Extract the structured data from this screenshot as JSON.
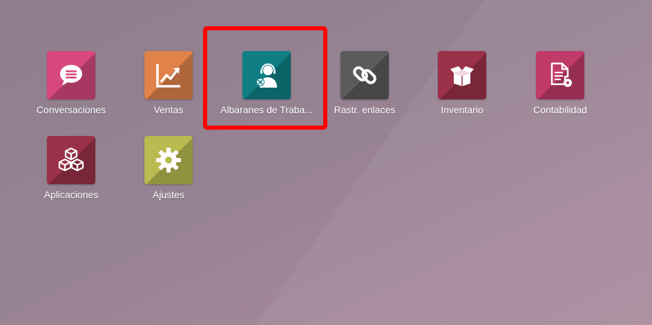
{
  "apps": [
    {
      "label": "Conversaciones",
      "icon": "chat-bubble-icon",
      "color": "#d6487e"
    },
    {
      "label": "Ventas",
      "icon": "trending-up-chart-icon",
      "color": "#e0824a"
    },
    {
      "label": "Albaranes de Traba...",
      "icon": "support-agent-headset-icon",
      "color": "#0f7f85"
    },
    {
      "label": "Rastr. enlaces",
      "icon": "link-icon",
      "color": "#5b5b5b"
    },
    {
      "label": "Inventario",
      "icon": "open-box-icon",
      "color": "#9a3148"
    },
    {
      "label": "Contabilidad",
      "icon": "document-gear-icon",
      "color": "#c03a6a"
    },
    {
      "label": "Aplicaciones",
      "icon": "cubes-icon",
      "color": "#9a3148"
    },
    {
      "label": "Ajustes",
      "icon": "gear-icon",
      "color": "#b9ba4f"
    }
  ],
  "highlight": {
    "target": "Albaranes de Traba...",
    "color": "#ff0000"
  }
}
